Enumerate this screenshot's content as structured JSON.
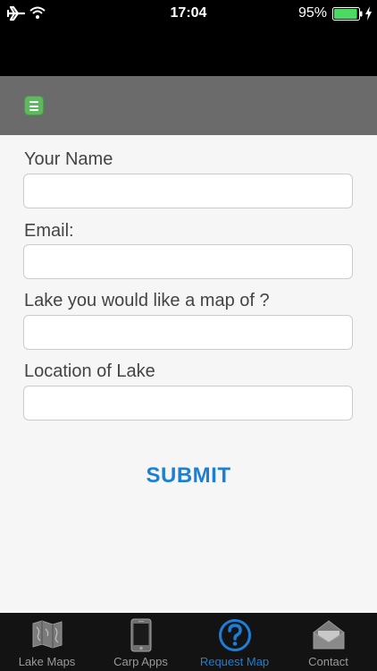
{
  "status_bar": {
    "time": "17:04",
    "battery_percent": "95%",
    "battery_level": 0.95,
    "icons": [
      "airplane-icon",
      "wifi-icon",
      "battery-icon",
      "charging-icon"
    ]
  },
  "toolbar": {
    "menu_icon": "hamburger-menu-icon",
    "accent_color": "#5fb85f"
  },
  "form": {
    "name_label": "Your Name",
    "name_value": "",
    "email_label": "Email:",
    "email_value": "",
    "lake_label": "Lake you would like a map of ?",
    "lake_value": "",
    "location_label": "Location of Lake",
    "location_value": "",
    "submit_label": "SUBMIT",
    "submit_color": "#1a7fd8"
  },
  "tabs": [
    {
      "label": "Lake Maps",
      "icon": "map-icon",
      "active": false
    },
    {
      "label": "Carp Apps",
      "icon": "phone-icon",
      "active": false
    },
    {
      "label": "Request Map",
      "icon": "question-icon",
      "active": true
    },
    {
      "label": "Contact",
      "icon": "envelope-icon",
      "active": false
    }
  ]
}
